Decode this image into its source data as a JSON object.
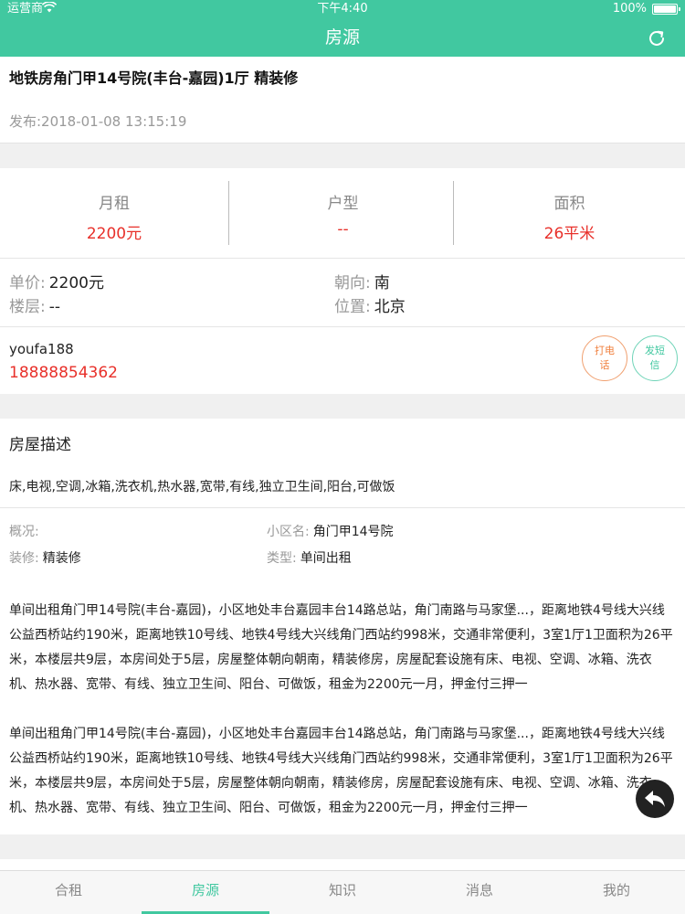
{
  "status_bar": {
    "carrier": "运营商",
    "time": "下午4:40",
    "battery_text": "100%",
    "battery_level": 1.0
  },
  "nav": {
    "title": "房源",
    "refresh_icon": "refresh-icon"
  },
  "listing": {
    "title": "地铁房角门甲14号院(丰台-嘉园)1厅 精装修",
    "published": "发布:2018-01-08 13:15:19"
  },
  "stats": [
    {
      "label": "月租",
      "value": "2200元"
    },
    {
      "label": "户型",
      "value": "--"
    },
    {
      "label": "面积",
      "value": "26平米"
    }
  ],
  "details": {
    "unit_price_label": "单价:",
    "unit_price": "2200元",
    "orientation_label": "朝向:",
    "orientation": "南",
    "floor_label": "楼层:",
    "floor": "--",
    "location_label": "位置:",
    "location": "北京"
  },
  "contact": {
    "name": "youfa188",
    "phone": "18888854362",
    "call_label": "打电话",
    "sms_label": "发短信"
  },
  "description": {
    "title": "房屋描述",
    "amenities": "床,电视,空调,冰箱,洗衣机,热水器,宽带,有线,独立卫生间,阳台,可做饭",
    "overview_label": "概况:",
    "overview": "",
    "community_label": "小区名:",
    "community": "角门甲14号院",
    "decoration_label": "装修:",
    "decoration": "精装修",
    "type_label": "类型:",
    "type": "单间出租",
    "paragraphs": [
      "单间出租角门甲14号院(丰台-嘉园)，小区地处丰台嘉园丰台14路总站，角门南路与马家堡...，距离地铁4号线大兴线公益西桥站约190米，距离地铁10号线、地铁4号线大兴线角门西站约998米，交通非常便利，3室1厅1卫面积为26平米，本楼层共9层，本房间处于5层，房屋整体朝向朝南，精装修房，房屋配套设施有床、电视、空调、冰箱、洗衣机、热水器、宽带、有线、独立卫生间、阳台、可做饭，租金为2200元一月，押金付三押一",
      "单间出租角门甲14号院(丰台-嘉园)，小区地处丰台嘉园丰台14路总站，角门南路与马家堡...，距离地铁4号线大兴线公益西桥站约190米，距离地铁10号线、地铁4号线大兴线角门西站约998米，交通非常便利，3室1厅1卫面积为26平米，本楼层共9层，本房间处于5层，房屋整体朝向朝南，精装修房，房屋配套设施有床、电视、空调、冰箱、洗衣机、热水器、宽带、有线、独立卫生间、阳台、可做饭，租金为2200元一月，押金付三押一"
    ]
  },
  "tabs": [
    {
      "label": "合租",
      "active": false
    },
    {
      "label": "房源",
      "active": true
    },
    {
      "label": "知识",
      "active": false
    },
    {
      "label": "消息",
      "active": false
    },
    {
      "label": "我的",
      "active": false
    }
  ],
  "colors": {
    "brand": "#41c8a0",
    "price": "#e8302a",
    "call": "#f0803e"
  }
}
